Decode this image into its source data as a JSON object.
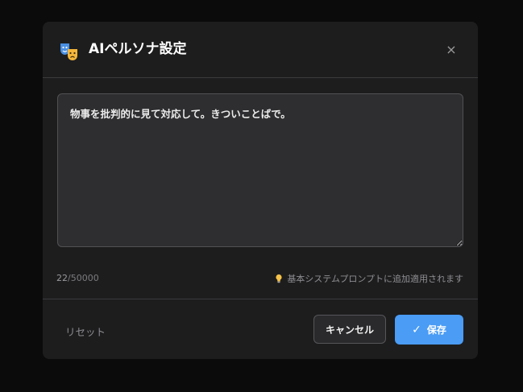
{
  "dialog": {
    "title": "AIペルソナ設定",
    "header_icon": "theater-masks-icon",
    "close_label": "×"
  },
  "persona": {
    "text": "物事を批判的に見て対応して。きついことばで。",
    "count_current": "22",
    "count_max": "/50000",
    "hint_icon": "lightbulb-icon",
    "hint": "基本システムプロンプトに追加適用されます"
  },
  "footer": {
    "reset_label": "リセット",
    "cancel_label": "キャンセル",
    "save_icon": "✓",
    "save_label": "保存"
  },
  "colors": {
    "accent": "#4a9cf5",
    "background": "#1d1d1e",
    "textarea_bg": "#2e2e30"
  }
}
